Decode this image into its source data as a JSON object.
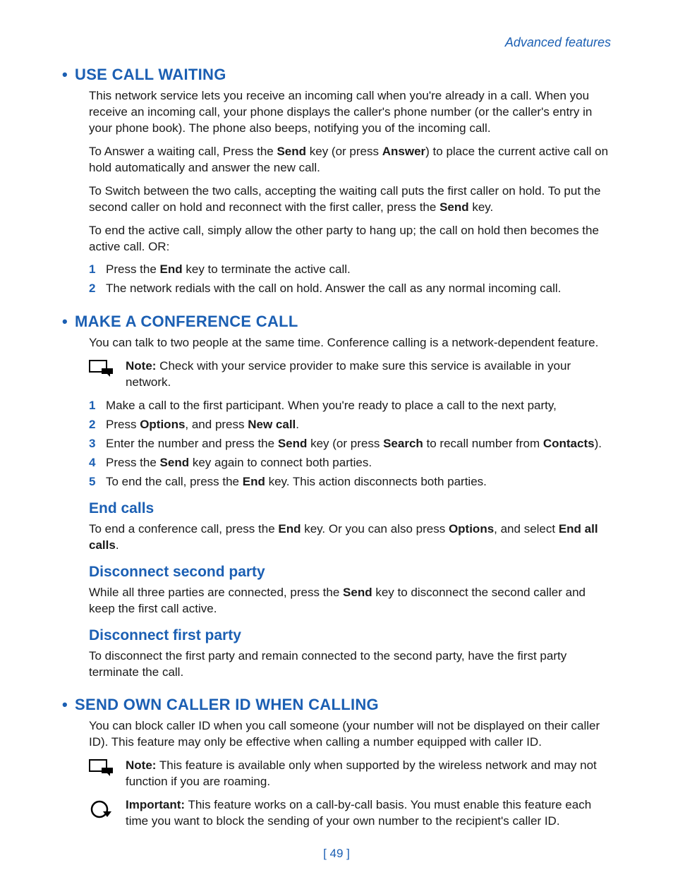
{
  "header": {
    "right": "Advanced features"
  },
  "sections": {
    "useCallWaiting": {
      "title": "USE CALL WAITING",
      "p1": "This network service lets you receive an incoming call when you're already in a call. When you receive an incoming call, your phone displays the caller's phone number (or the caller's entry in your phone book). The phone also beeps, notifying you of the incoming call.",
      "p2_a": "To Answer a waiting call, Press the ",
      "p2_b": " key (or press ",
      "p2_c": ") to place the current active call on hold automatically and answer the new call.",
      "p3_a": "To Switch between the two calls, accepting the waiting call puts the first caller on hold. To put the second caller on hold and reconnect with the first caller, press the ",
      "p3_b": " key.",
      "p4": "To end the active call, simply allow the other party to hang up; the call on hold then becomes the active call. OR:",
      "list": {
        "i1_a": "Press the ",
        "i1_b": " key to terminate the active call.",
        "i2": "The network redials with the call on hold. Answer the call as any normal incoming call."
      }
    },
    "conference": {
      "title": "MAKE A CONFERENCE CALL",
      "p1": "You can talk to two people at the same time. Conference calling is a network-dependent feature.",
      "note_a": "Note:",
      "note_b": " Check with your service provider to make sure this service is available in your network.",
      "list": {
        "i1": "Make a call to the first participant. When you're ready to place a call to the next party,",
        "i2_a": "Press ",
        "i2_b": ", and press ",
        "i2_c": ".",
        "i3_a": "Enter the number and press the ",
        "i3_b": " key (or press ",
        "i3_c": " to recall number from ",
        "i3_d": ").",
        "i4_a": "Press the ",
        "i4_b": " key again to connect both parties.",
        "i5_a": "To end the call, press the ",
        "i5_b": " key. This action disconnects both parties."
      },
      "endCalls": {
        "title": "End calls",
        "p_a": "To end a conference call, press the ",
        "p_b": " key. Or you can also press ",
        "p_c": ", and select ",
        "p_d": "."
      },
      "disc2": {
        "title": "Disconnect second party",
        "p_a": "While all three parties are connected, press the ",
        "p_b": " key to disconnect the second caller and keep the first call active."
      },
      "disc1": {
        "title": "Disconnect first party",
        "p": "To disconnect the first party and remain connected to the second party, have the first party terminate the call."
      }
    },
    "callerId": {
      "title": "SEND OWN CALLER ID WHEN CALLING",
      "p1": "You can block caller ID when you call someone (your number will not be displayed on their caller ID). This feature may only be effective when calling a number equipped with caller ID.",
      "note_a": "Note:",
      "note_b": " This feature is available only when supported by the wireless network and may not function if you are roaming.",
      "imp_a": "Important:",
      "imp_b": " This feature works on a call-by-call basis. You must enable this feature each time you want to block the sending of your own number to the recipient's caller ID."
    }
  },
  "keys": {
    "send": "Send",
    "answer": "Answer",
    "end": "End",
    "options": "Options",
    "newCall": "New call",
    "search": "Search",
    "contacts": "Contacts",
    "endAll": "End all calls"
  },
  "nums": {
    "n1": "1",
    "n2": "2",
    "n3": "3",
    "n4": "4",
    "n5": "5"
  },
  "footer": {
    "page": "[ 49 ]"
  }
}
